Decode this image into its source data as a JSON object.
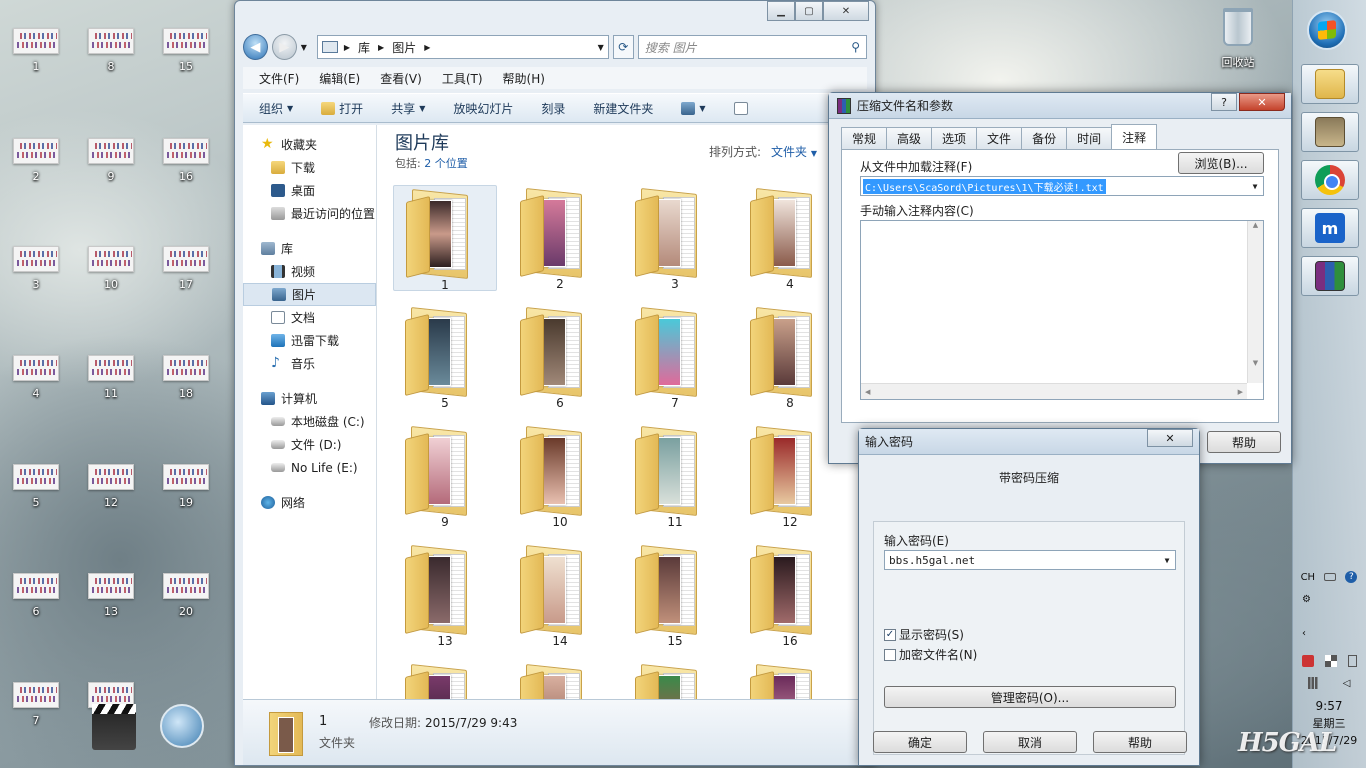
{
  "desktop": {
    "icons": [
      "1",
      "2",
      "3",
      "4",
      "5",
      "6",
      "7",
      "8",
      "9",
      "10",
      "11",
      "12",
      "13",
      "15",
      "16",
      "17",
      "18",
      "19",
      "20"
    ],
    "recycle_bin": "回收站"
  },
  "explorer": {
    "breadcrumb": [
      "库",
      "图片"
    ],
    "search_placeholder": "搜索 图片",
    "menu": [
      "文件(F)",
      "编辑(E)",
      "查看(V)",
      "工具(T)",
      "帮助(H)"
    ],
    "commands": {
      "organize": "组织",
      "open": "打开",
      "share": "共享",
      "slideshow": "放映幻灯片",
      "burn": "刻录",
      "new_folder": "新建文件夹"
    },
    "nav": {
      "favorites": "收藏夹",
      "downloads": "下载",
      "desktop": "桌面",
      "recent": "最近访问的位置",
      "libraries": "库",
      "videos": "视频",
      "pictures": "图片",
      "documents": "文档",
      "xunlei": "迅雷下载",
      "music": "音乐",
      "computer": "计算机",
      "disk_c": "本地磁盘 (C:)",
      "disk_d": "文件 (D:)",
      "disk_e": "No Life (E:)",
      "network": "网络"
    },
    "library_title": "图片库",
    "includes_label": "包括:",
    "includes_link": "2 个位置",
    "sort_label": "排列方式:",
    "sort_value": "文件夹",
    "folders": [
      "1",
      "2",
      "3",
      "4",
      "5",
      "6",
      "7",
      "8",
      "9",
      "10",
      "11",
      "12",
      "13",
      "14",
      "15",
      "16"
    ],
    "details": {
      "name": "1",
      "date_label": "修改日期:",
      "date_value": "2015/7/29 9:43",
      "type": "文件夹"
    }
  },
  "archive_dialog": {
    "title": "压缩文件名和参数",
    "tabs": [
      "常规",
      "高级",
      "选项",
      "文件",
      "备份",
      "时间",
      "注释"
    ],
    "load_comment_label": "从文件中加载注释(F)",
    "browse_button": "浏览(B)...",
    "comment_file": "C:\\Users\\ScaSord\\Pictures\\1\\下载必读!.txt",
    "manual_label": "手动输入注释内容(C)",
    "help_button": "帮助"
  },
  "password_dialog": {
    "title": "输入密码",
    "heading": "带密码压缩",
    "password_label": "输入密码(E)",
    "password_value": "bbs.h5gal.net",
    "show_password": "显示密码(S)",
    "encrypt_names": "加密文件名(N)",
    "manage_button": "管理密码(O)...",
    "ok_button": "确定",
    "cancel_button": "取消",
    "help_button": "帮助"
  },
  "tray": {
    "lang": "CH",
    "time": "9:57",
    "weekday": "星期三",
    "date": "2015/7/29"
  },
  "watermark": "H5GAL"
}
